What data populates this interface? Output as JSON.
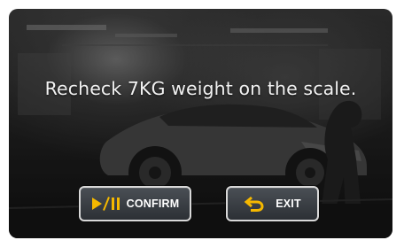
{
  "dialog": {
    "message": "Recheck 7KG weight on the scale."
  },
  "buttons": {
    "confirm": {
      "label": "CONFIRM",
      "icon": "play-pause-icon",
      "icon_color": "#f5b800"
    },
    "exit": {
      "label": "EXIT",
      "icon": "return-arrow-icon",
      "icon_color": "#f5b800"
    }
  }
}
